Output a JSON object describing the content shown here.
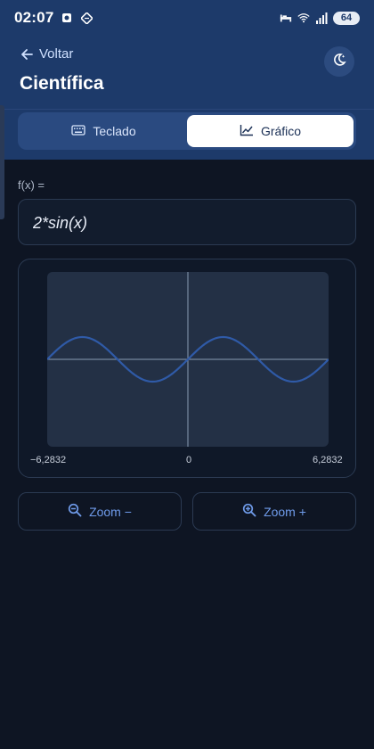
{
  "status": {
    "time": "02:07",
    "battery": "64"
  },
  "header": {
    "back_label": "Voltar",
    "title": "Científica"
  },
  "tabs": [
    {
      "label": "Teclado",
      "active": false,
      "icon": "keyboard-icon"
    },
    {
      "label": "Gráfico",
      "active": true,
      "icon": "chart-line-icon"
    }
  ],
  "function": {
    "label": "f(x) =",
    "expression": "2*sin(x)"
  },
  "graph": {
    "x_min_label": "−6,2832",
    "x_mid_label": "0",
    "x_max_label": "6,2832",
    "x_range": [
      -6.2832,
      6.2832
    ],
    "y_amplitude": 2,
    "line_color": "#2f5aa7",
    "axis_color": "#8a9bb3",
    "plot_bg": "#233045"
  },
  "buttons": {
    "zoom_out": "Zoom −",
    "zoom_in": "Zoom +"
  },
  "colors": {
    "primary": "#1d3a6a",
    "accent": "#6f9bea",
    "background": "#0e1523"
  }
}
